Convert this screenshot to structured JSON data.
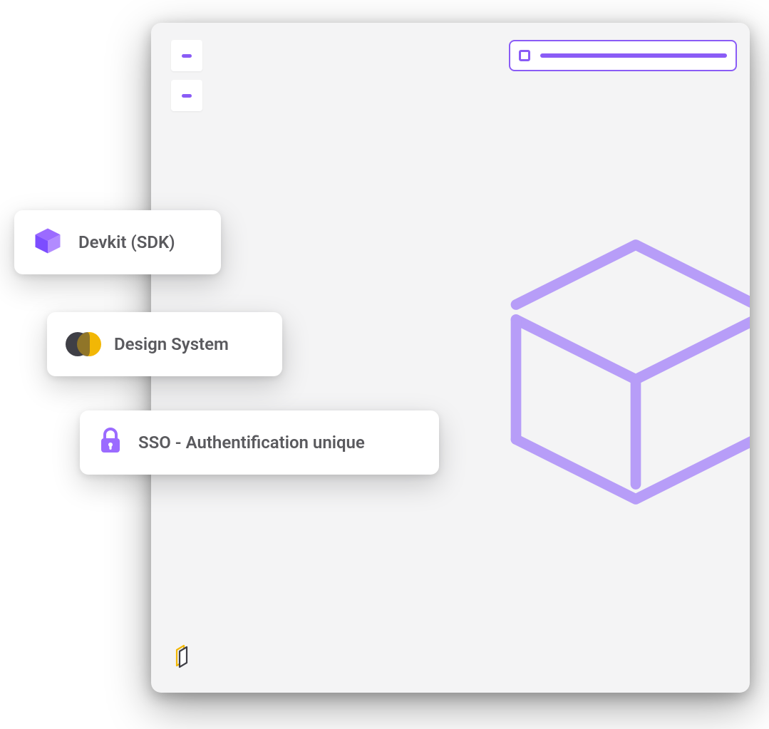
{
  "colors": {
    "accent": "#8a5cf6",
    "gold": "#f2b705",
    "text": "#5a5a5e",
    "panel": "#f4f4f5",
    "card": "#ffffff"
  },
  "cards": {
    "devkit": {
      "label": "Devkit (SDK)",
      "icon": "cube-icon"
    },
    "design": {
      "label": "Design System",
      "icon": "overlap-circles-icon"
    },
    "sso": {
      "label": "SSO - Authentification unique",
      "icon": "lock-icon"
    }
  }
}
